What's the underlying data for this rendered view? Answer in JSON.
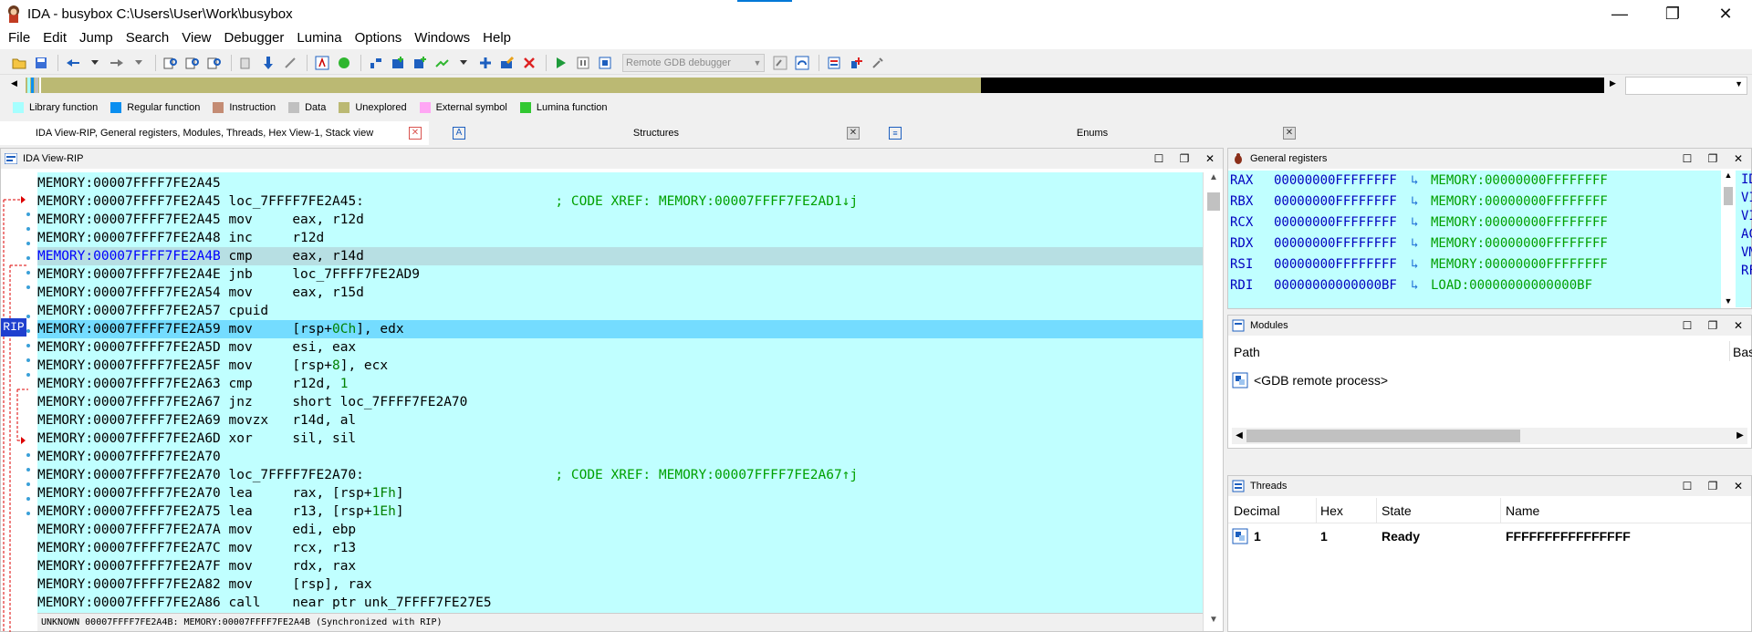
{
  "window": {
    "title": "IDA - busybox C:\\Users\\User\\Work\\busybox",
    "controls": [
      "—",
      "❐",
      "✕"
    ]
  },
  "menu": [
    "File",
    "Edit",
    "Jump",
    "Search",
    "View",
    "Debugger",
    "Lumina",
    "Options",
    "Windows",
    "Help"
  ],
  "toolbar": {
    "debugger_select": "Remote GDB debugger"
  },
  "legend": [
    {
      "label": "Library function",
      "color": "#a6ffff"
    },
    {
      "label": "Regular function",
      "color": "#0a8ff0"
    },
    {
      "label": "Instruction",
      "color": "#c48c74"
    },
    {
      "label": "Data",
      "color": "#c0c0c0"
    },
    {
      "label": "Unexplored",
      "color": "#bbb973"
    },
    {
      "label": "External symbol",
      "color": "#ffa6f4"
    },
    {
      "label": "Lumina function",
      "color": "#32c832"
    }
  ],
  "tabs": [
    {
      "label": "IDA View-RIP, General registers, Modules, Threads, Hex View-1, Stack view",
      "close": "✕"
    },
    {
      "label": "Structures",
      "close": "✕"
    },
    {
      "label": "Enums",
      "close": "✕"
    }
  ],
  "ida_view": {
    "title": "IDA View-RIP",
    "rip_label": "RIP",
    "lines": [
      {
        "addr": "MEMORY:00007FFFF7FE2A45",
        "label": "",
        "mnem": "",
        "ops": "",
        "num": "",
        "ops2": "",
        "comment": ""
      },
      {
        "addr": "MEMORY:00007FFFF7FE2A45",
        "label": "loc_7FFFF7FE2A45:",
        "mnem": "",
        "ops": "",
        "num": "",
        "ops2": "",
        "comment": "; CODE XREF: MEMORY:00007FFFF7FE2AD1↓j"
      },
      {
        "addr": "MEMORY:00007FFFF7FE2A45",
        "label": "",
        "mnem": "mov",
        "ops": "eax, r12d",
        "num": "",
        "ops2": "",
        "comment": ""
      },
      {
        "addr": "MEMORY:00007FFFF7FE2A48",
        "label": "",
        "mnem": "inc",
        "ops": "r12d",
        "num": "",
        "ops2": "",
        "comment": ""
      },
      {
        "addr": "MEMORY:00007FFFF7FE2A4B",
        "label": "",
        "mnem": "cmp",
        "ops": "eax, r14d",
        "num": "",
        "ops2": "",
        "comment": ""
      },
      {
        "addr": "MEMORY:00007FFFF7FE2A4E",
        "label": "",
        "mnem": "jnb",
        "ops": "loc_7FFFF7FE2AD9",
        "num": "",
        "ops2": "",
        "comment": ""
      },
      {
        "addr": "MEMORY:00007FFFF7FE2A54",
        "label": "",
        "mnem": "mov",
        "ops": "eax, r15d",
        "num": "",
        "ops2": "",
        "comment": ""
      },
      {
        "addr": "MEMORY:00007FFFF7FE2A57",
        "label": "",
        "mnem": "cpuid",
        "ops": "",
        "num": "",
        "ops2": "",
        "comment": ""
      },
      {
        "addr": "MEMORY:00007FFFF7FE2A59",
        "label": "",
        "mnem": "mov",
        "ops": "[rsp+",
        "num": "0Ch",
        "ops2": "], edx",
        "comment": ""
      },
      {
        "addr": "MEMORY:00007FFFF7FE2A5D",
        "label": "",
        "mnem": "mov",
        "ops": "esi, eax",
        "num": "",
        "ops2": "",
        "comment": ""
      },
      {
        "addr": "MEMORY:00007FFFF7FE2A5F",
        "label": "",
        "mnem": "mov",
        "ops": "[rsp+",
        "num": "8",
        "ops2": "], ecx",
        "comment": ""
      },
      {
        "addr": "MEMORY:00007FFFF7FE2A63",
        "label": "",
        "mnem": "cmp",
        "ops": "r12d, ",
        "num": "1",
        "ops2": "",
        "comment": ""
      },
      {
        "addr": "MEMORY:00007FFFF7FE2A67",
        "label": "",
        "mnem": "jnz",
        "ops": "short loc_7FFFF7FE2A70",
        "num": "",
        "ops2": "",
        "comment": ""
      },
      {
        "addr": "MEMORY:00007FFFF7FE2A69",
        "label": "",
        "mnem": "movzx",
        "ops": "r14d, al",
        "num": "",
        "ops2": "",
        "comment": ""
      },
      {
        "addr": "MEMORY:00007FFFF7FE2A6D",
        "label": "",
        "mnem": "xor",
        "ops": "sil, sil",
        "num": "",
        "ops2": "",
        "comment": ""
      },
      {
        "addr": "MEMORY:00007FFFF7FE2A70",
        "label": "",
        "mnem": "",
        "ops": "",
        "num": "",
        "ops2": "",
        "comment": ""
      },
      {
        "addr": "MEMORY:00007FFFF7FE2A70",
        "label": "loc_7FFFF7FE2A70:",
        "mnem": "",
        "ops": "",
        "num": "",
        "ops2": "",
        "comment": "; CODE XREF: MEMORY:00007FFFF7FE2A67↑j"
      },
      {
        "addr": "MEMORY:00007FFFF7FE2A70",
        "label": "",
        "mnem": "lea",
        "ops": "rax, [rsp+",
        "num": "1Fh",
        "ops2": "]",
        "comment": ""
      },
      {
        "addr": "MEMORY:00007FFFF7FE2A75",
        "label": "",
        "mnem": "lea",
        "ops": "r13, [rsp+",
        "num": "1Eh",
        "ops2": "]",
        "comment": ""
      },
      {
        "addr": "MEMORY:00007FFFF7FE2A7A",
        "label": "",
        "mnem": "mov",
        "ops": "edi, ebp",
        "num": "",
        "ops2": "",
        "comment": ""
      },
      {
        "addr": "MEMORY:00007FFFF7FE2A7C",
        "label": "",
        "mnem": "mov",
        "ops": "rcx, r13",
        "num": "",
        "ops2": "",
        "comment": ""
      },
      {
        "addr": "MEMORY:00007FFFF7FE2A7F",
        "label": "",
        "mnem": "mov",
        "ops": "rdx, rax",
        "num": "",
        "ops2": "",
        "comment": ""
      },
      {
        "addr": "MEMORY:00007FFFF7FE2A82",
        "label": "",
        "mnem": "mov",
        "ops": "[rsp], rax",
        "num": "",
        "ops2": "",
        "comment": ""
      },
      {
        "addr": "MEMORY:00007FFFF7FE2A86",
        "label": "",
        "mnem": "call",
        "ops": "near ptr unk_7FFFF7FE27E5",
        "num": "",
        "ops2": "",
        "comment": ""
      }
    ],
    "status": "UNKNOWN 00007FFFF7FE2A4B: MEMORY:00007FFFF7FE2A4B (Synchronized with RIP)"
  },
  "registers": {
    "title": "General registers",
    "rows": [
      {
        "name": "RAX",
        "value": "00000000FFFFFFFF",
        "symbol": "MEMORY:00000000FFFFFFFF"
      },
      {
        "name": "RBX",
        "value": "00000000FFFFFFFF",
        "symbol": "MEMORY:00000000FFFFFFFF"
      },
      {
        "name": "RCX",
        "value": "00000000FFFFFFFF",
        "symbol": "MEMORY:00000000FFFFFFFF"
      },
      {
        "name": "RDX",
        "value": "00000000FFFFFFFF",
        "symbol": "MEMORY:00000000FFFFFFFF"
      },
      {
        "name": "RSI",
        "value": "00000000FFFFFFFF",
        "symbol": "MEMORY:00000000FFFFFFFF"
      },
      {
        "name": "RDI",
        "value": "00000000000000BF",
        "symbol": "LOAD:00000000000000BF"
      }
    ],
    "flags": [
      "ID",
      "VI",
      "VI",
      "AC",
      "VM",
      "RF"
    ]
  },
  "modules": {
    "title": "Modules",
    "col_path": "Path",
    "col_base": "Bas",
    "rows": [
      "<GDB remote process>"
    ]
  },
  "threads": {
    "title": "Threads",
    "cols": [
      "Decimal",
      "Hex",
      "State",
      "Name"
    ],
    "rows": [
      {
        "decimal": "1",
        "hex": "1",
        "state": "Ready",
        "name": "FFFFFFFFFFFFFFFF"
      }
    ]
  }
}
